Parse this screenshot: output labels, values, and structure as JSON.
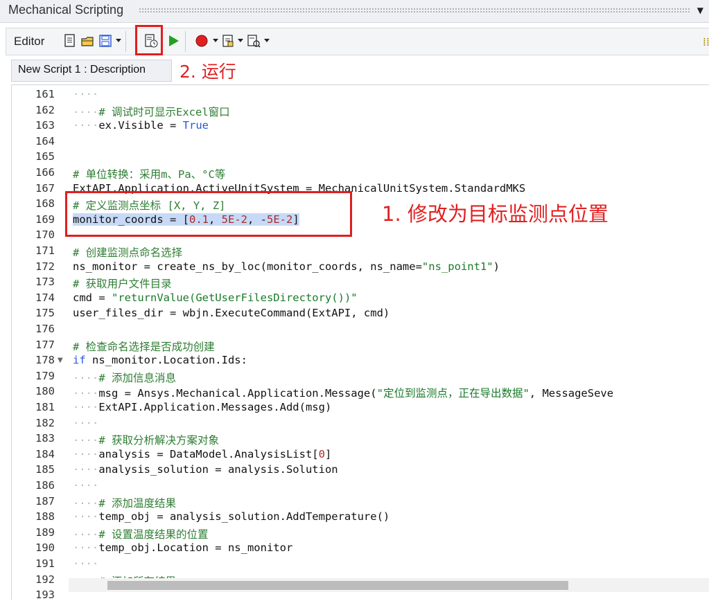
{
  "titlebar": {
    "title": "Mechanical Scripting",
    "menu_icon": "chevron-down-icon"
  },
  "toolbar": {
    "label": "Editor",
    "icons": [
      "new-script-icon",
      "open-folder-icon",
      "save-icon",
      "run-script-icon",
      "play-icon",
      "record-icon",
      "snippet-icon",
      "debug-icon"
    ],
    "right_icon": "pin-icon"
  },
  "description_bar": {
    "text": "New Script 1 : Description"
  },
  "annotations": {
    "run": "2. 运行",
    "modify": "1. 修改为目标监测点位置",
    "color": "#e01e1e"
  },
  "code_lines": [
    {
      "num": "161",
      "text": "····"
    },
    {
      "num": "162",
      "text": "····# 调试时可显示Excel窗口"
    },
    {
      "num": "163",
      "text": "····ex.Visible = True"
    },
    {
      "num": "164",
      "text": ""
    },
    {
      "num": "165",
      "text": ""
    },
    {
      "num": "166",
      "text": "# 单位转换：采用m、Pa、°C等"
    },
    {
      "num": "167",
      "text": "ExtAPI.Application.ActiveUnitSystem = MechanicalUnitSystem.StandardMKS"
    },
    {
      "num": "168",
      "text": "# 定义监测点坐标 [X, Y, Z]"
    },
    {
      "num": "169",
      "text": "monitor_coords = [0.1, 5E-2, -5E-2]"
    },
    {
      "num": "170",
      "text": ""
    },
    {
      "num": "171",
      "text": "# 创建监测点命名选择"
    },
    {
      "num": "172",
      "text": "ns_monitor = create_ns_by_loc(monitor_coords, ns_name=\"ns_point1\")"
    },
    {
      "num": "173",
      "text": "# 获取用户文件目录"
    },
    {
      "num": "174",
      "text": "cmd = \"returnValue(GetUserFilesDirectory())\""
    },
    {
      "num": "175",
      "text": "user_files_dir = wbjn.ExecuteCommand(ExtAPI, cmd)"
    },
    {
      "num": "176",
      "text": ""
    },
    {
      "num": "177",
      "text": "# 检查命名选择是否成功创建"
    },
    {
      "num": "178",
      "text": "if ns_monitor.Location.Ids:"
    },
    {
      "num": "179",
      "text": "····# 添加信息消息"
    },
    {
      "num": "180",
      "text": "····msg = Ansys.Mechanical.Application.Message(\"定位到监测点，正在导出数据\", MessageSeve"
    },
    {
      "num": "181",
      "text": "····ExtAPI.Application.Messages.Add(msg)"
    },
    {
      "num": "182",
      "text": "····"
    },
    {
      "num": "183",
      "text": "····# 获取分析解决方案对象"
    },
    {
      "num": "184",
      "text": "····analysis = DataModel.AnalysisList[0]"
    },
    {
      "num": "185",
      "text": "····analysis_solution = analysis.Solution"
    },
    {
      "num": "186",
      "text": "····"
    },
    {
      "num": "187",
      "text": "····# 添加温度结果"
    },
    {
      "num": "188",
      "text": "····temp_obj = analysis_solution.AddTemperature()"
    },
    {
      "num": "189",
      "text": "····# 设置温度结果的位置"
    },
    {
      "num": "190",
      "text": "····temp_obj.Location = ns_monitor"
    },
    {
      "num": "191",
      "text": "····"
    },
    {
      "num": "192",
      "text": "····# 添加所有结果"
    },
    {
      "num": "193",
      "text": ""
    }
  ]
}
